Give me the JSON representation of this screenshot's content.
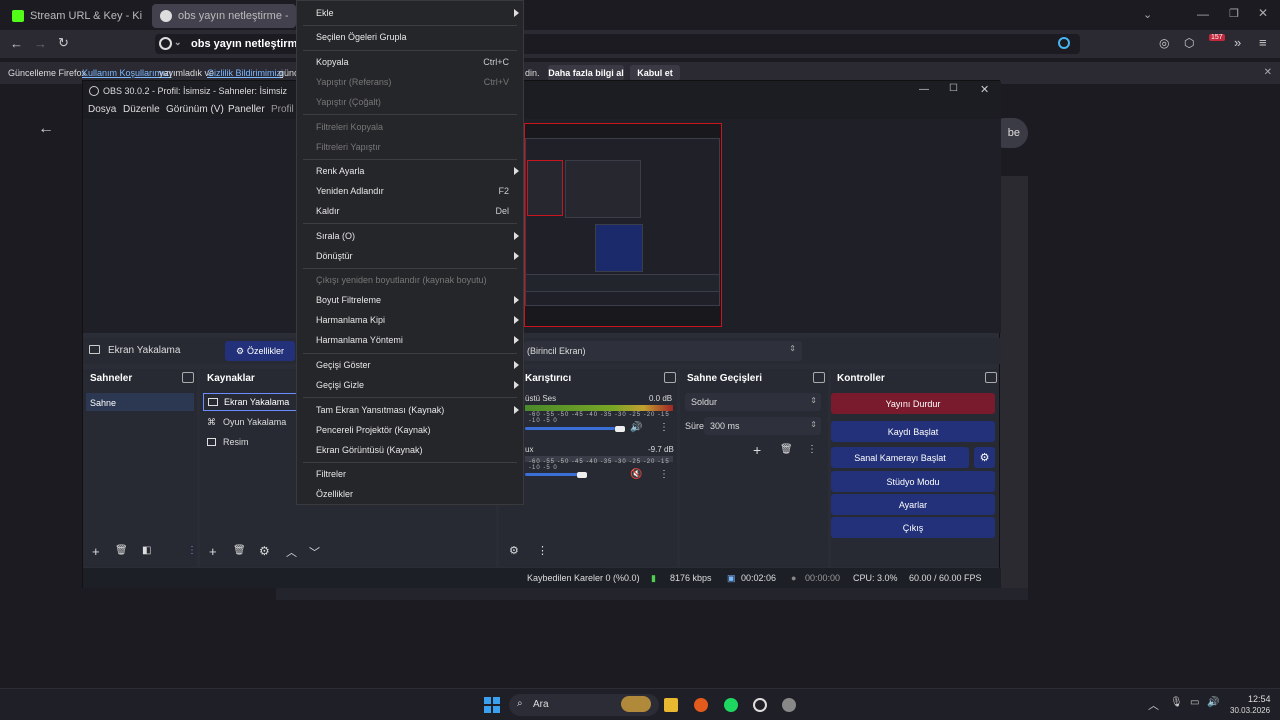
{
  "browser": {
    "tabs": [
      {
        "label": "Stream URL & Key - Kick Dashb",
        "icon_color": "#53fc18"
      },
      {
        "label": "obs yayın netleştirme - Google",
        "icon_color": "#dddddd"
      }
    ],
    "url_text": "obs yayın netleştirme",
    "badge_count": "157",
    "notification": {
      "prefix": "Güncelleme Firefox",
      "link1": "Kullanım Koşullarımızı",
      "middle": "yayımladık ve",
      "link2": "Gizlilik Bildirimimizi",
      "suffix": "günc",
      "tail": "din.",
      "learn_more": "Daha fazla bilgi al",
      "accept": "Kabul et"
    },
    "page_button_fragment": "be"
  },
  "obs": {
    "title": "OBS 30.0.2 - Profil: İsimsiz - Sahneler: İsimsiz",
    "menu": [
      "Dosya",
      "Düzenle",
      "Görünüm (V)",
      "Paneller",
      "Profil"
    ],
    "source_toolbar": {
      "source_name": "Ekran Yakalama",
      "properties": "Özellikler",
      "display": "(Birincil Ekran)"
    },
    "docks": {
      "scenes": {
        "title": "Sahneler",
        "items": [
          "Sahne"
        ]
      },
      "sources": {
        "title": "Kaynaklar",
        "items": [
          "Ekran Yakalama",
          "Oyun Yakalama",
          "Resim"
        ]
      },
      "mixer": {
        "title": "Karıştırıcı",
        "channels": [
          {
            "name": "üstü Ses",
            "level": "0.0 dB",
            "volume": 0.9,
            "muted": false
          },
          {
            "name": "ux",
            "level": "-9.7 dB",
            "volume": 0.55,
            "muted": true
          }
        ],
        "ticks": "-60 -55 -50 -45 -40 -35 -30 -25 -20 -15 -10 -5 0"
      },
      "transitions": {
        "title": "Sahne Geçişleri",
        "type": "Soldur",
        "duration_label": "Süre",
        "duration": "300 ms"
      },
      "controls": {
        "title": "Kontroller",
        "buttons": [
          "Yayını Durdur",
          "Kaydı Başlat",
          "Sanal Kamerayı Başlat",
          "Stüdyo Modu",
          "Ayarlar",
          "Çıkış"
        ]
      }
    },
    "status": {
      "dropped": "Kaybedilen Kareler 0 (%0.0)",
      "bitrate": "8176 kbps",
      "stream_time": "00:02:06",
      "rec_time": "00:00:00",
      "cpu": "CPU: 3.0%",
      "fps": "60.00 / 60.00 FPS"
    }
  },
  "context_menu": {
    "items": [
      {
        "label": "Ekle",
        "submenu": true
      },
      {
        "label": "Seçilen Ögeleri Grupla"
      },
      {
        "label": "Kopyala",
        "shortcut": "Ctrl+C"
      },
      {
        "label": "Yapıştır (Referans)",
        "shortcut": "Ctrl+V",
        "disabled": true
      },
      {
        "label": "Yapıştır (Çoğalt)",
        "disabled": true
      },
      {
        "label": "Filtreleri Kopyala",
        "disabled": true
      },
      {
        "label": "Filtreleri Yapıştır",
        "disabled": true
      },
      {
        "label": "Renk Ayarla",
        "submenu": true
      },
      {
        "label": "Yeniden Adlandır",
        "shortcut": "F2"
      },
      {
        "label": "Kaldır",
        "shortcut": "Del"
      },
      {
        "label": "Sırala (O)",
        "submenu": true
      },
      {
        "label": "Dönüştür",
        "submenu": true
      },
      {
        "label": "Çıkışı yeniden boyutlandır (kaynak boyutu)",
        "disabled": true
      },
      {
        "label": "Boyut Filtreleme",
        "submenu": true
      },
      {
        "label": "Harmanlama Kipi",
        "submenu": true
      },
      {
        "label": "Harmanlama Yöntemi",
        "submenu": true
      },
      {
        "label": "Geçişi Göster",
        "submenu": true
      },
      {
        "label": "Geçişi Gizle",
        "submenu": true
      },
      {
        "label": "Tam Ekran Yansıtması (Kaynak)",
        "submenu": true
      },
      {
        "label": "Pencereli Projektör (Kaynak)"
      },
      {
        "label": "Ekran Görüntüsü (Kaynak)"
      },
      {
        "label": "Filtreler"
      },
      {
        "label": "Özellikler"
      }
    ]
  },
  "taskbar": {
    "search": "Ara",
    "time": "12:54",
    "date": "30.03.2026"
  },
  "colors": {
    "accent_blue": "#22317a",
    "stop_red": "#7a1a2d",
    "selection_red": "#c9161e"
  }
}
